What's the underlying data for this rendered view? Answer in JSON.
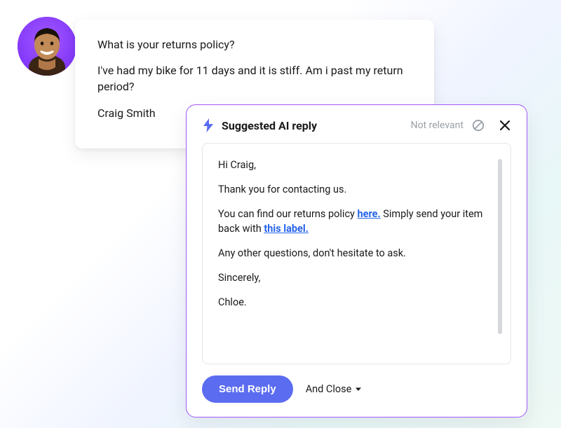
{
  "customer_message": {
    "line1": "What is your returns policy?",
    "line2": "I've had my bike for 11 days and it is stiff. Am i past my return period?",
    "signature": "Craig Smith"
  },
  "ai_panel": {
    "title": "Suggested AI reply",
    "not_relevant_label": "Not relevant",
    "reply": {
      "greeting": "Hi Craig,",
      "thanks": "Thank you for contacting us.",
      "policy_prefix": "You can find our returns policy ",
      "policy_link": "here.",
      "policy_mid": " Simply send your item back with ",
      "label_link": "this label.",
      "other_questions": "Any other questions, don't hesitate to ask.",
      "signoff": "Sincerely,",
      "agent_name": "Chloe."
    },
    "send_button": "Send Reply",
    "and_close": "And Close"
  }
}
